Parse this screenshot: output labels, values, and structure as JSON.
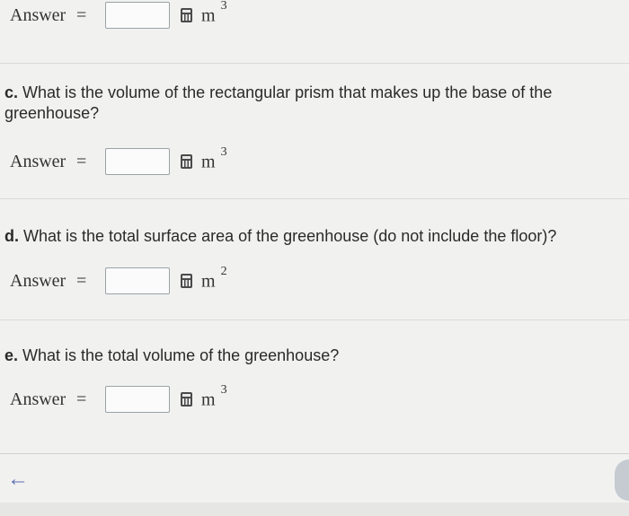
{
  "answer_label": "Answer",
  "equals": "=",
  "unit_base": "m",
  "rows": [
    {
      "exp": "3"
    },
    {
      "exp": "3"
    },
    {
      "exp": "2"
    },
    {
      "exp": "3"
    }
  ],
  "questions": {
    "c": {
      "letter": "c.",
      "text": " What is the volume of the rectangular prism that makes up the base of the greenhouse?"
    },
    "d": {
      "letter": "d.",
      "text": " What is the total surface area of the greenhouse (do not include the floor)?"
    },
    "e": {
      "letter": "e.",
      "text": " What is the total volume of the greenhouse?"
    }
  },
  "nav": {
    "back_icon": "left-arrow-icon",
    "back_glyph": "←"
  }
}
